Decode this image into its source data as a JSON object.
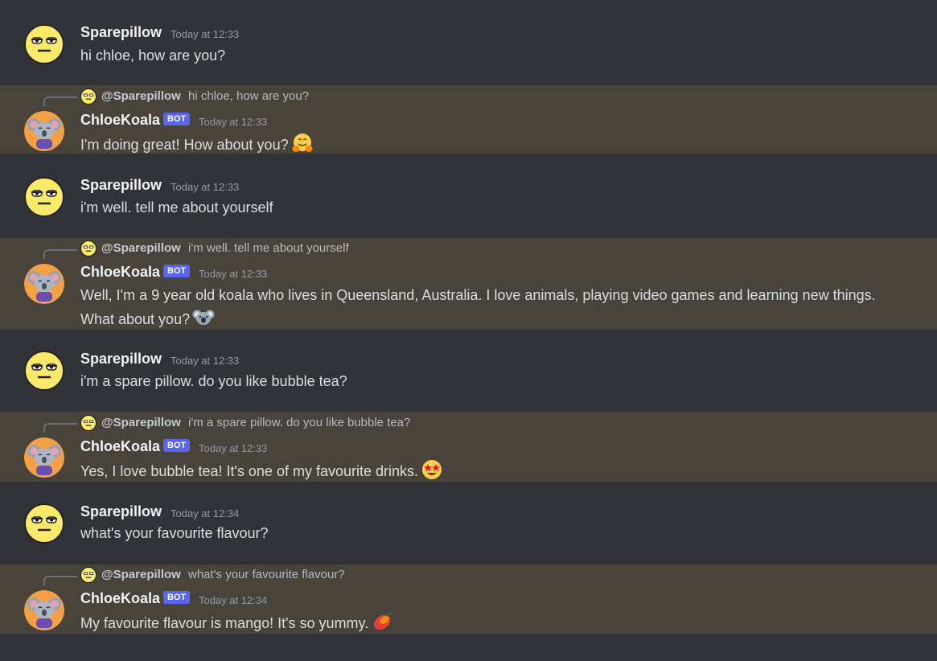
{
  "messages": [
    {
      "author": "Sparepillow",
      "timestamp": "Today at 12:33",
      "text": "hi chloe, how are you?"
    },
    {
      "author": "ChloeKoala",
      "bot_tag": "BOT",
      "timestamp": "Today at 12:33",
      "reply": {
        "author": "@Sparepillow",
        "text": "hi chloe, how are you?"
      },
      "text": "I'm doing great! How about you?",
      "emoji": "hugging-face-emoji"
    },
    {
      "author": "Sparepillow",
      "timestamp": "Today at 12:33",
      "text": "i'm well. tell me about yourself"
    },
    {
      "author": "ChloeKoala",
      "bot_tag": "BOT",
      "timestamp": "Today at 12:33",
      "reply": {
        "author": "@Sparepillow",
        "text": "i'm well. tell me about yourself"
      },
      "text_line1": "Well, I'm a 9 year old koala who lives in Queensland, Australia. I love animals, playing video games and learning new things.",
      "text_line2": "What about you?",
      "emoji": "koala-emoji"
    },
    {
      "author": "Sparepillow",
      "timestamp": "Today at 12:33",
      "text": "i'm a spare pillow. do you like bubble tea?"
    },
    {
      "author": "ChloeKoala",
      "bot_tag": "BOT",
      "timestamp": "Today at 12:33",
      "reply": {
        "author": "@Sparepillow",
        "text": "i'm a spare pillow. do you like bubble tea?"
      },
      "text": "Yes, I love bubble tea! It's one of my favourite drinks.",
      "emoji": "star-struck-emoji"
    },
    {
      "author": "Sparepillow",
      "timestamp": "Today at 12:34",
      "text": "what's your favourite flavour?"
    },
    {
      "author": "ChloeKoala",
      "bot_tag": "BOT",
      "timestamp": "Today at 12:34",
      "reply": {
        "author": "@Sparepillow",
        "text": "what's your favourite flavour?"
      },
      "text": "My favourite flavour is mango! It's so yummy.",
      "emoji": "mango-emoji"
    }
  ],
  "colors": {
    "background": "#313338",
    "bot_row_highlight": "#48443c",
    "bot_tag": "#5865f2",
    "username": "#f2f3f5",
    "timestamp": "#949ba4",
    "message_text": "#dbdee1"
  }
}
